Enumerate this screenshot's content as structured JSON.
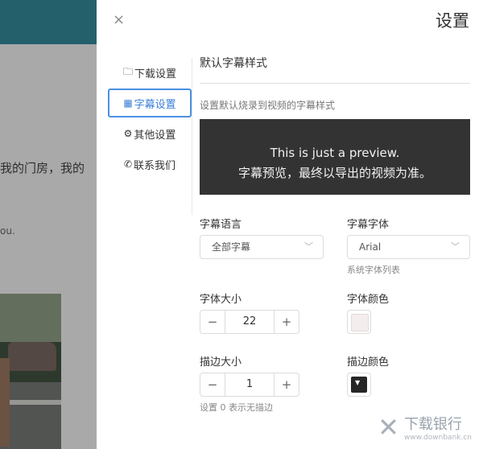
{
  "background": {
    "snippet": "我的门房，我的",
    "snippet2": "ou."
  },
  "dialog": {
    "title": "设置",
    "close_icon": "×"
  },
  "sidebar": {
    "items": [
      {
        "icon": "folder-icon",
        "glyph": "🗀",
        "label": "下载设置"
      },
      {
        "icon": "subtitle-icon",
        "glyph": "▦",
        "label": "字幕设置",
        "active": true
      },
      {
        "icon": "gear-icon",
        "glyph": "⚙",
        "label": "其他设置"
      },
      {
        "icon": "phone-icon",
        "glyph": "✆",
        "label": "联系我们"
      }
    ]
  },
  "section": {
    "title": "默认字幕样式",
    "description": "设置默认烧录到视频的字幕样式",
    "preview_line1": "This is just a preview.",
    "preview_line2": "字幕预览，最终以导出的视频为准。"
  },
  "fields": {
    "language_label": "字幕语言",
    "language_value": "全部字幕",
    "font_label": "字幕字体",
    "font_value": "Arial",
    "font_hint": "系统字体列表",
    "size_label": "字体大小",
    "size_value": "22",
    "color_label": "字体颜色",
    "color_value": "#f3eded",
    "stroke_label": "描边大小",
    "stroke_value": "1",
    "stroke_hint": "设置 0 表示无描边",
    "stroke_color_label": "描边颜色",
    "stroke_color_value": "#262626"
  },
  "stepper": {
    "minus": "−",
    "plus": "+"
  },
  "watermark": {
    "text": "下载银行",
    "url": "www.downbank.cn"
  },
  "colors": {
    "accent": "#4a90e2",
    "preview_bg": "#333333"
  }
}
